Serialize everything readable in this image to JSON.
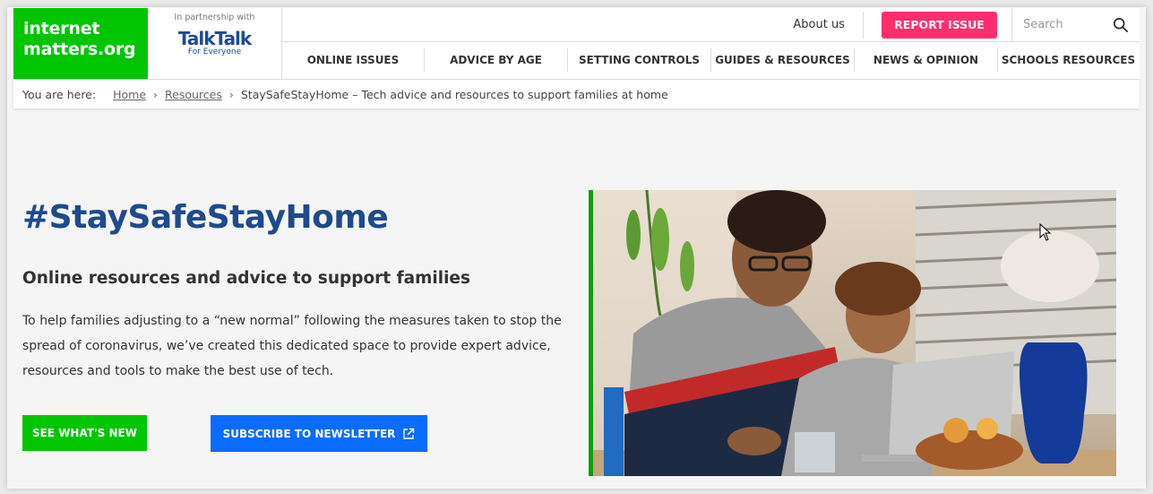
{
  "logo": {
    "line1": "internet",
    "line2": "matters.org"
  },
  "partner": {
    "label": "In partnership with",
    "brand": "TalkTalk",
    "tagline": "For Everyone"
  },
  "top_nav": {
    "about": "About us",
    "report": "REPORT ISSUE",
    "search_placeholder": "Search"
  },
  "menu": [
    {
      "label": "ONLINE ISSUES"
    },
    {
      "label": "ADVICE BY AGE"
    },
    {
      "label": "SETTING CONTROLS"
    },
    {
      "label": "GUIDES & RESOURCES"
    },
    {
      "label": "NEWS & OPINION"
    },
    {
      "label": "SCHOOLS RESOURCES"
    }
  ],
  "breadcrumb": {
    "prefix": "You are here:",
    "items": [
      "Home",
      "Resources"
    ],
    "separator": "›",
    "current": "StaySafeStayHome – Tech advice and resources to support families at home"
  },
  "hero": {
    "title": "#StaySafeStayHome",
    "subtitle": "Online resources and advice to support families",
    "body": "To help families adjusting to a “new normal” following the measures taken to stop the spread of coronavirus, we’ve created this dedicated space to provide expert advice, resources and tools to make the best use of tech.",
    "btn_new": "SEE WHAT'S NEW",
    "btn_subscribe": "SUBSCRIBE TO NEWSLETTER",
    "image_alt": "Father and child using a laptop at a table"
  },
  "colors": {
    "brand_green": "#00c500",
    "report_pink": "#ff2f6e",
    "subscribe_blue": "#0a6cff",
    "title_blue": "#1f4a8c"
  }
}
